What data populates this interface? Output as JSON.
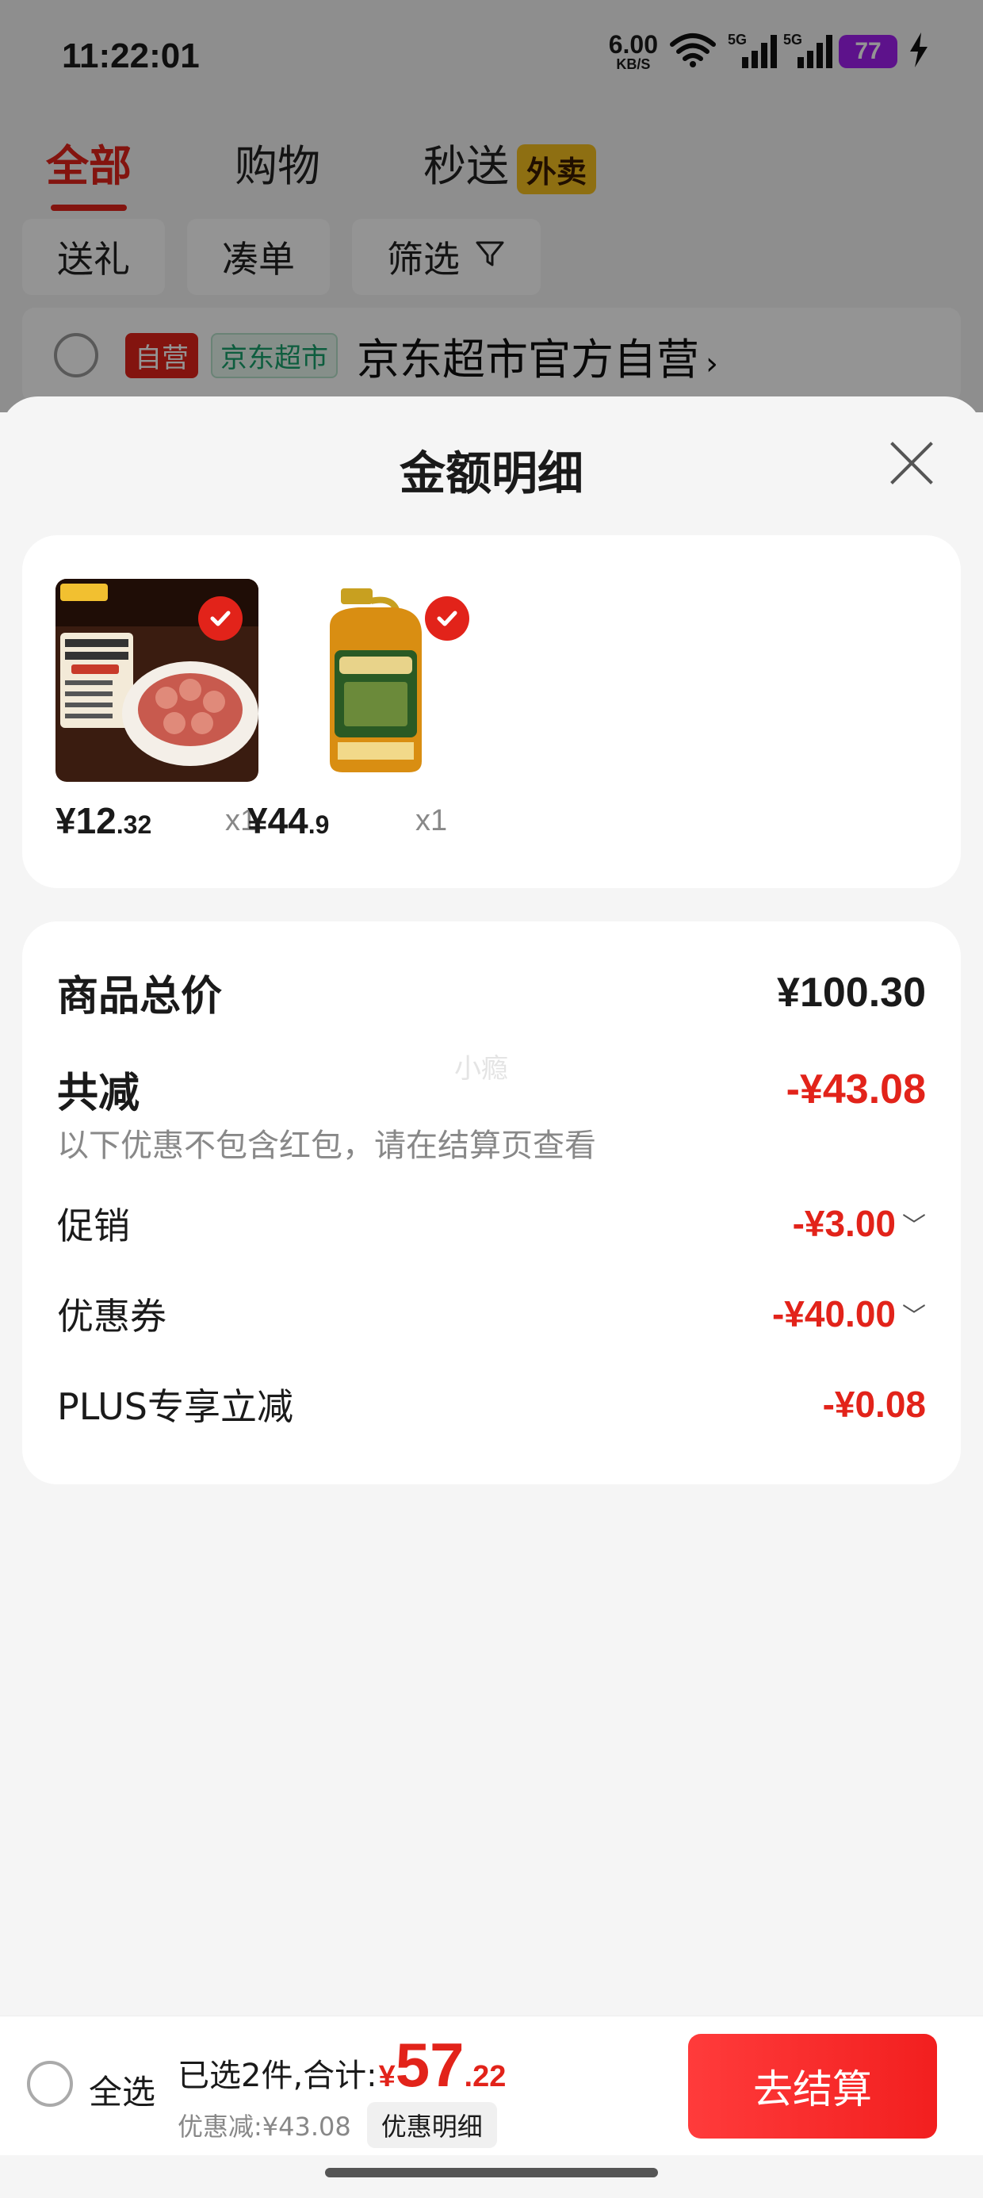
{
  "status_bar": {
    "time": "11:22:01",
    "net_speed_value": "6.00",
    "net_speed_unit": "KB/S",
    "signal1": "5G",
    "signal2": "5G",
    "battery": "77"
  },
  "background_cart": {
    "tabs": [
      {
        "label": "全部",
        "active": true
      },
      {
        "label": "购物",
        "active": false
      },
      {
        "label": "秒送",
        "active": false,
        "badge": "外卖"
      }
    ],
    "filters": [
      "送礼",
      "凑单",
      "筛选"
    ],
    "shop": {
      "badge_self": "自营",
      "badge_market": "京东超市",
      "name": "京东超市官方自营",
      "chevron": "›"
    }
  },
  "sheet": {
    "title": "金额明细",
    "products": [
      {
        "price_int": "¥12",
        "price_dec": ".32",
        "qty": "x1",
        "selected": true
      },
      {
        "price_int": "¥44",
        "price_dec": ".9",
        "qty": "x1",
        "selected": true
      }
    ],
    "summary": {
      "total_label": "商品总价",
      "total_value": "¥100.30",
      "discount_label": "共减",
      "discount_value": "-¥43.08",
      "note": "以下优惠不包含红包，请在结算页查看",
      "watermark": "小瘾",
      "items": [
        {
          "label": "促销",
          "value": "-¥3.00",
          "expandable": true
        },
        {
          "label": "优惠券",
          "value": "-¥40.00",
          "expandable": true
        },
        {
          "label": "PLUS专享立减",
          "value": "-¥0.08",
          "expandable": false
        }
      ]
    }
  },
  "bottom_bar": {
    "select_all": "全选",
    "selected_text": "已选2件,合计:",
    "yen": "¥",
    "total_int": "57",
    "total_dec": ".22",
    "saved_text": "优惠减:¥43.08",
    "detail_button": "优惠明细",
    "checkout_button": "去结算"
  },
  "colors": {
    "accent_red": "#e2231a",
    "checkout_gradient_start": "#ff3b3b",
    "battery_purple": "#a020f0",
    "badge_yellow": "#f4c020"
  }
}
